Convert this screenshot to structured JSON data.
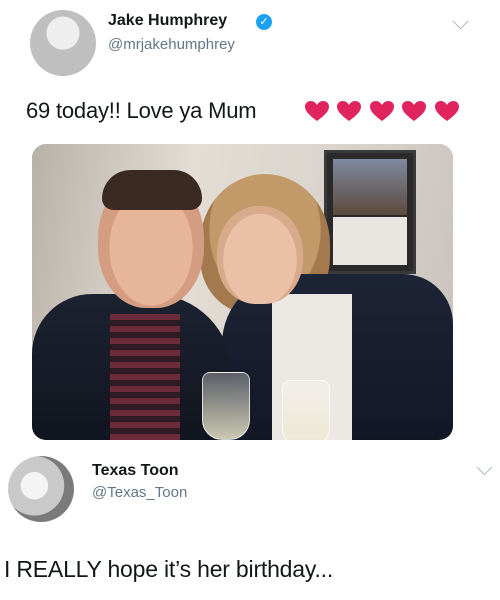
{
  "tweets": [
    {
      "author_name": "Jake Humphrey",
      "author_handle": "@mrjakehumphrey",
      "verified": true,
      "text": "69 today!! Love ya Mum",
      "emoji": [
        "red-heart",
        "red-heart",
        "red-heart",
        "red-heart",
        "red-heart"
      ],
      "has_photo": true
    },
    {
      "author_name": "Texas Toon",
      "author_handle": "@Texas_Toon",
      "verified": false,
      "text": "I REALLY hope it’s her birthday..."
    }
  ],
  "colors": {
    "verified": "#1da1f2",
    "heart": "#e0245e",
    "handle": "#657786",
    "text": "#14171a"
  },
  "icons": {
    "verified": "verified-check-icon",
    "menu": "chevron-down-icon",
    "heart": "red-heart-emoji"
  }
}
